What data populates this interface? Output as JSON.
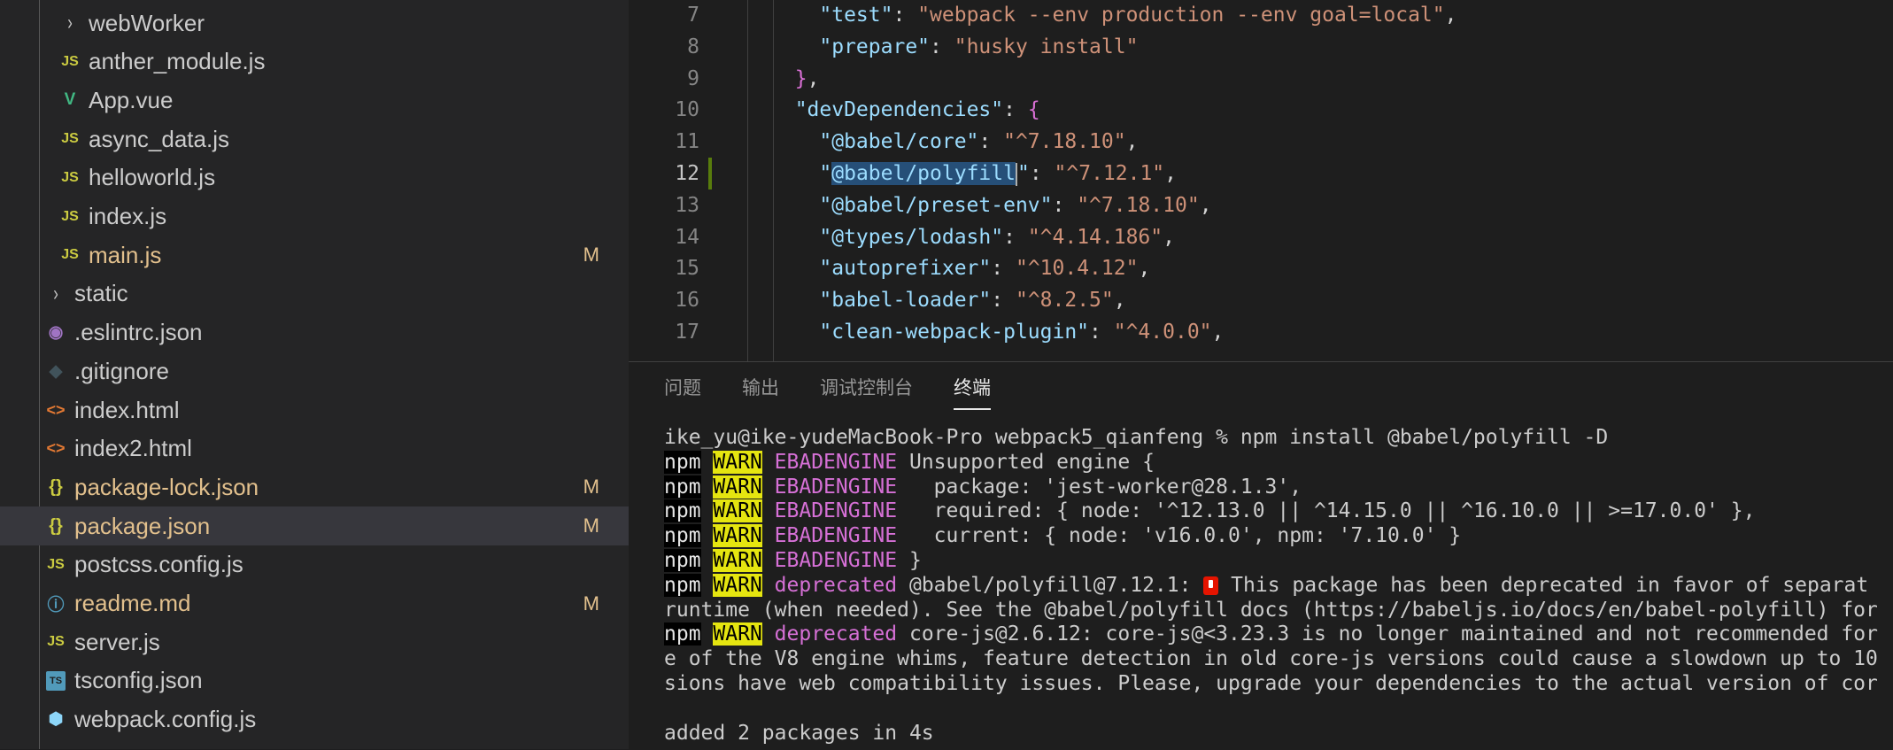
{
  "explorer": {
    "items": [
      {
        "label": "webWorker",
        "icon": "chevron-right-icon",
        "glyph": "›",
        "cls": "chev",
        "level": 2,
        "selected": false,
        "modified": false,
        "badge": ""
      },
      {
        "label": "anther_module.js",
        "icon": "js-file-icon",
        "glyph": "JS",
        "cls": "js",
        "level": 2,
        "selected": false,
        "modified": false,
        "badge": ""
      },
      {
        "label": "App.vue",
        "icon": "vue-file-icon",
        "glyph": "V",
        "cls": "vue",
        "level": 2,
        "selected": false,
        "modified": false,
        "badge": ""
      },
      {
        "label": "async_data.js",
        "icon": "js-file-icon",
        "glyph": "JS",
        "cls": "js",
        "level": 2,
        "selected": false,
        "modified": false,
        "badge": ""
      },
      {
        "label": "helloworld.js",
        "icon": "js-file-icon",
        "glyph": "JS",
        "cls": "js",
        "level": 2,
        "selected": false,
        "modified": false,
        "badge": ""
      },
      {
        "label": "index.js",
        "icon": "js-file-icon",
        "glyph": "JS",
        "cls": "js",
        "level": 2,
        "selected": false,
        "modified": false,
        "badge": ""
      },
      {
        "label": "main.js",
        "icon": "js-file-icon",
        "glyph": "JS",
        "cls": "js",
        "level": 2,
        "selected": false,
        "modified": true,
        "badge": "M"
      },
      {
        "label": "static",
        "icon": "chevron-right-icon",
        "glyph": "›",
        "cls": "chev",
        "level": 1,
        "selected": false,
        "modified": false,
        "badge": ""
      },
      {
        "label": ".eslintrc.json",
        "icon": "eslint-file-icon",
        "glyph": "◉",
        "cls": "dot",
        "level": 1,
        "selected": false,
        "modified": false,
        "badge": ""
      },
      {
        "label": ".gitignore",
        "icon": "git-file-icon",
        "glyph": "◆",
        "cls": "git",
        "level": 1,
        "selected": false,
        "modified": false,
        "badge": ""
      },
      {
        "label": "index.html",
        "icon": "html-file-icon",
        "glyph": "<>",
        "cls": "html",
        "level": 1,
        "selected": false,
        "modified": false,
        "badge": ""
      },
      {
        "label": "index2.html",
        "icon": "html-file-icon",
        "glyph": "<>",
        "cls": "html",
        "level": 1,
        "selected": false,
        "modified": false,
        "badge": ""
      },
      {
        "label": "package-lock.json",
        "icon": "json-file-icon",
        "glyph": "{}",
        "cls": "json",
        "level": 1,
        "selected": false,
        "modified": true,
        "badge": "M"
      },
      {
        "label": "package.json",
        "icon": "json-file-icon",
        "glyph": "{}",
        "cls": "json",
        "level": 1,
        "selected": true,
        "modified": true,
        "badge": "M"
      },
      {
        "label": "postcss.config.js",
        "icon": "js-file-icon",
        "glyph": "JS",
        "cls": "js",
        "level": 1,
        "selected": false,
        "modified": false,
        "badge": ""
      },
      {
        "label": "readme.md",
        "icon": "info-file-icon",
        "glyph": "ⓘ",
        "cls": "info",
        "level": 1,
        "selected": false,
        "modified": true,
        "badge": "M"
      },
      {
        "label": "server.js",
        "icon": "js-file-icon",
        "glyph": "JS",
        "cls": "js",
        "level": 1,
        "selected": false,
        "modified": false,
        "badge": ""
      },
      {
        "label": "tsconfig.json",
        "icon": "ts-file-icon",
        "glyph": "TS",
        "cls": "ts",
        "level": 1,
        "selected": false,
        "modified": false,
        "badge": ""
      },
      {
        "label": "webpack.config.js",
        "icon": "webpack-file-icon",
        "glyph": "⬢",
        "cls": "wp",
        "level": 1,
        "selected": false,
        "modified": false,
        "badge": ""
      }
    ]
  },
  "editor": {
    "lines": [
      {
        "num": "7",
        "indent": "    ",
        "tokens": [
          {
            "t": "\"test\"",
            "c": "k"
          },
          {
            "t": ": ",
            "c": "p"
          },
          {
            "t": "\"webpack --env production --env goal=local\"",
            "c": "s"
          },
          {
            "t": ",",
            "c": "p"
          }
        ]
      },
      {
        "num": "8",
        "indent": "    ",
        "tokens": [
          {
            "t": "\"prepare\"",
            "c": "k"
          },
          {
            "t": ": ",
            "c": "p"
          },
          {
            "t": "\"husky install\"",
            "c": "s"
          }
        ]
      },
      {
        "num": "9",
        "indent": "  ",
        "tokens": [
          {
            "t": "}",
            "c": "br"
          },
          {
            "t": ",",
            "c": "p"
          }
        ]
      },
      {
        "num": "10",
        "indent": "  ",
        "tokens": [
          {
            "t": "\"devDependencies\"",
            "c": "k"
          },
          {
            "t": ": ",
            "c": "p"
          },
          {
            "t": "{",
            "c": "br"
          }
        ]
      },
      {
        "num": "11",
        "indent": "    ",
        "tokens": [
          {
            "t": "\"@babel/core\"",
            "c": "k"
          },
          {
            "t": ": ",
            "c": "p"
          },
          {
            "t": "\"^7.18.10\"",
            "c": "s"
          },
          {
            "t": ",",
            "c": "p"
          }
        ]
      },
      {
        "num": "12",
        "indent": "    ",
        "active": true,
        "tokens": [
          {
            "t": "\"",
            "c": "k"
          },
          {
            "t": "@babel/polyfill",
            "c": "k hl"
          },
          {
            "t": "|",
            "c": "cursor"
          },
          {
            "t": "\"",
            "c": "k"
          },
          {
            "t": ": ",
            "c": "p"
          },
          {
            "t": "\"^7.12.1\"",
            "c": "s"
          },
          {
            "t": ",",
            "c": "p"
          }
        ]
      },
      {
        "num": "13",
        "indent": "    ",
        "tokens": [
          {
            "t": "\"@babel/preset-env\"",
            "c": "k"
          },
          {
            "t": ": ",
            "c": "p"
          },
          {
            "t": "\"^7.18.10\"",
            "c": "s"
          },
          {
            "t": ",",
            "c": "p"
          }
        ]
      },
      {
        "num": "14",
        "indent": "    ",
        "tokens": [
          {
            "t": "\"@types/lodash\"",
            "c": "k"
          },
          {
            "t": ": ",
            "c": "p"
          },
          {
            "t": "\"^4.14.186\"",
            "c": "s"
          },
          {
            "t": ",",
            "c": "p"
          }
        ]
      },
      {
        "num": "15",
        "indent": "    ",
        "tokens": [
          {
            "t": "\"autoprefixer\"",
            "c": "k"
          },
          {
            "t": ": ",
            "c": "p"
          },
          {
            "t": "\"^10.4.12\"",
            "c": "s"
          },
          {
            "t": ",",
            "c": "p"
          }
        ]
      },
      {
        "num": "16",
        "indent": "    ",
        "tokens": [
          {
            "t": "\"babel-loader\"",
            "c": "k"
          },
          {
            "t": ": ",
            "c": "p"
          },
          {
            "t": "\"^8.2.5\"",
            "c": "s"
          },
          {
            "t": ",",
            "c": "p"
          }
        ]
      },
      {
        "num": "17",
        "indent": "    ",
        "tokens": [
          {
            "t": "\"clean-webpack-plugin\"",
            "c": "k"
          },
          {
            "t": ": ",
            "c": "p"
          },
          {
            "t": "\"^4.0.0\"",
            "c": "s"
          },
          {
            "t": ",",
            "c": "p"
          }
        ]
      }
    ]
  },
  "panel": {
    "tabs": [
      {
        "label": "问题",
        "active": false
      },
      {
        "label": "输出",
        "active": false
      },
      {
        "label": "调试控制台",
        "active": false
      },
      {
        "label": "终端",
        "active": true
      }
    ]
  },
  "terminal": {
    "lines": [
      [
        {
          "t": "ike_yu@ike-yudeMacBook-Pro webpack5_qianfeng % npm install @babel/polyfill -D",
          "c": ""
        }
      ],
      [
        {
          "t": "npm",
          "c": "npm"
        },
        {
          "t": " ",
          "c": ""
        },
        {
          "t": "WARN",
          "c": "warn"
        },
        {
          "t": " ",
          "c": ""
        },
        {
          "t": "EBADENGINE",
          "c": "mag"
        },
        {
          "t": " Unsupported engine {",
          "c": ""
        }
      ],
      [
        {
          "t": "npm",
          "c": "npm"
        },
        {
          "t": " ",
          "c": ""
        },
        {
          "t": "WARN",
          "c": "warn"
        },
        {
          "t": " ",
          "c": ""
        },
        {
          "t": "EBADENGINE",
          "c": "mag"
        },
        {
          "t": "   package: 'jest-worker@28.1.3',",
          "c": ""
        }
      ],
      [
        {
          "t": "npm",
          "c": "npm"
        },
        {
          "t": " ",
          "c": ""
        },
        {
          "t": "WARN",
          "c": "warn"
        },
        {
          "t": " ",
          "c": ""
        },
        {
          "t": "EBADENGINE",
          "c": "mag"
        },
        {
          "t": "   required: { node: '^12.13.0 || ^14.15.0 || ^16.10.0 || >=17.0.0' },",
          "c": ""
        }
      ],
      [
        {
          "t": "npm",
          "c": "npm"
        },
        {
          "t": " ",
          "c": ""
        },
        {
          "t": "WARN",
          "c": "warn"
        },
        {
          "t": " ",
          "c": ""
        },
        {
          "t": "EBADENGINE",
          "c": "mag"
        },
        {
          "t": "   current: { node: 'v16.0.0', npm: '7.10.0' }",
          "c": ""
        }
      ],
      [
        {
          "t": "npm",
          "c": "npm"
        },
        {
          "t": " ",
          "c": ""
        },
        {
          "t": "WARN",
          "c": "warn"
        },
        {
          "t": " ",
          "c": ""
        },
        {
          "t": "EBADENGINE",
          "c": "mag"
        },
        {
          "t": " }",
          "c": ""
        }
      ],
      [
        {
          "t": "npm",
          "c": "npm"
        },
        {
          "t": " ",
          "c": ""
        },
        {
          "t": "WARN",
          "c": "warn"
        },
        {
          "t": " ",
          "c": ""
        },
        {
          "t": "deprecated",
          "c": "mag"
        },
        {
          "t": " @babel/polyfill@7.12.1: ",
          "c": ""
        },
        {
          "t": "",
          "c": "emoji"
        },
        {
          "t": " This package has been deprecated in favor of separat",
          "c": ""
        }
      ],
      [
        {
          "t": "runtime (when needed). See the @babel/polyfill docs (https://babeljs.io/docs/en/babel-polyfill) for",
          "c": ""
        }
      ],
      [
        {
          "t": "npm",
          "c": "npm"
        },
        {
          "t": " ",
          "c": ""
        },
        {
          "t": "WARN",
          "c": "warn"
        },
        {
          "t": " ",
          "c": ""
        },
        {
          "t": "deprecated",
          "c": "mag"
        },
        {
          "t": " core-js@2.6.12: core-js@<3.23.3 is no longer maintained and not recommended for",
          "c": ""
        }
      ],
      [
        {
          "t": "e of the V8 engine whims, feature detection in old core-js versions could cause a slowdown up to 10",
          "c": ""
        }
      ],
      [
        {
          "t": "sions have web compatibility issues. Please, upgrade your dependencies to the actual version of cor",
          "c": ""
        }
      ],
      [
        {
          "t": "",
          "c": ""
        }
      ],
      [
        {
          "t": "added 2 packages in 4s",
          "c": ""
        }
      ]
    ]
  }
}
